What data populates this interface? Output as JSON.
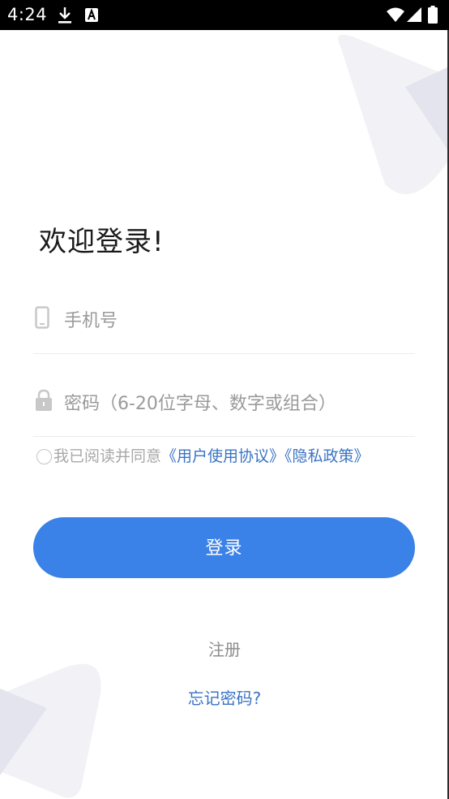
{
  "status_bar": {
    "time": "4:24",
    "icons": [
      "download-icon",
      "a-notification-icon",
      "wifi-icon",
      "signal-icon",
      "battery-icon"
    ]
  },
  "login": {
    "welcome": "欢迎登录!",
    "phone_placeholder": "手机号",
    "password_placeholder": "密码（6-20位字母、数字或组合）",
    "agree_prefix": "我已阅读并同意",
    "user_agreement_link": "《用户使用协议》",
    "privacy_link": "《隐私政策》",
    "login_button": "登录",
    "register_link": "注册",
    "forgot_password_link": "忘记密码?"
  },
  "colors": {
    "accent": "#3a81e8",
    "link": "#3a73c4",
    "placeholder": "#9a9a9a",
    "status_bar": "#000000"
  }
}
